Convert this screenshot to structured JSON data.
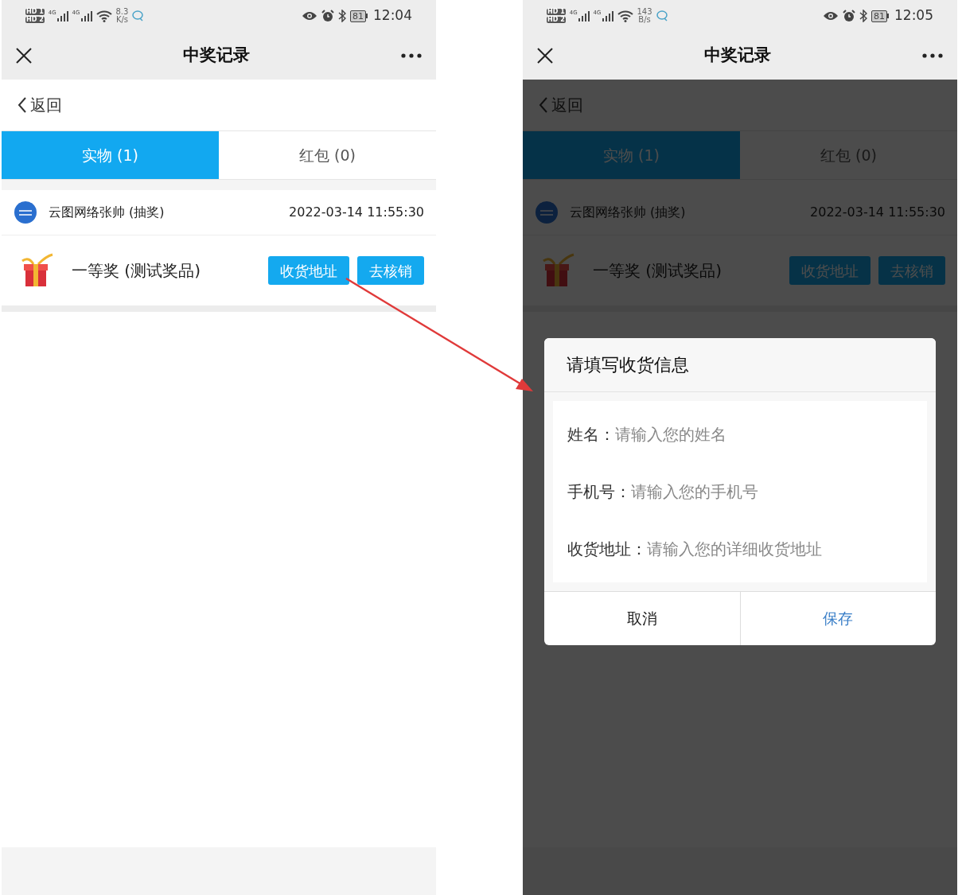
{
  "screens": [
    {
      "status_bar": {
        "sims": [
          {
            "label": "HD",
            "slot": "1"
          },
          {
            "label": "HD",
            "slot": "2"
          }
        ],
        "signals": [
          {
            "label": "4G"
          },
          {
            "label": "4G"
          }
        ],
        "speed": "8.3",
        "speed_unit": "K/s",
        "battery": "81",
        "time": "12:04"
      },
      "nav": {
        "title": "中奖记录"
      },
      "back": {
        "label": "返回"
      },
      "tabs": [
        {
          "label": "实物 (1)",
          "selected": true
        },
        {
          "label": "红包 (0)",
          "selected": false
        }
      ],
      "record": {
        "name": "云图网络张帅 (抽奖)",
        "time": "2022-03-14 11:55:30",
        "prize": "一等奖 (测试奖品)",
        "buttons": [
          "收货地址",
          "去核销"
        ]
      }
    },
    {
      "status_bar": {
        "sims": [
          {
            "label": "HD",
            "slot": "1"
          },
          {
            "label": "HD",
            "slot": "2"
          }
        ],
        "signals": [
          {
            "label": "4G"
          },
          {
            "label": "4G"
          }
        ],
        "speed": "143",
        "speed_unit": "B/s",
        "battery": "81",
        "time": "12:05"
      },
      "nav": {
        "title": "中奖记录"
      },
      "back": {
        "label": "返回"
      },
      "tabs": [
        {
          "label": "实物 (1)",
          "selected": true
        },
        {
          "label": "红包 (0)",
          "selected": false
        }
      ],
      "record": {
        "name": "云图网络张帅 (抽奖)",
        "time": "2022-03-14 11:55:30",
        "prize": "一等奖 (测试奖品)",
        "buttons": [
          "收货地址",
          "去核销"
        ]
      },
      "dialog": {
        "title": "请填写收货信息",
        "fields": [
          {
            "label": "姓名：",
            "placeholder": "请输入您的姓名"
          },
          {
            "label": "手机号：",
            "placeholder": "请输入您的手机号"
          },
          {
            "label": "收货地址：",
            "placeholder": "请输入您的详细收货地址"
          }
        ],
        "buttons": [
          {
            "label": "取消",
            "kind": "cancel"
          },
          {
            "label": "保存",
            "kind": "confirm"
          }
        ]
      }
    }
  ]
}
